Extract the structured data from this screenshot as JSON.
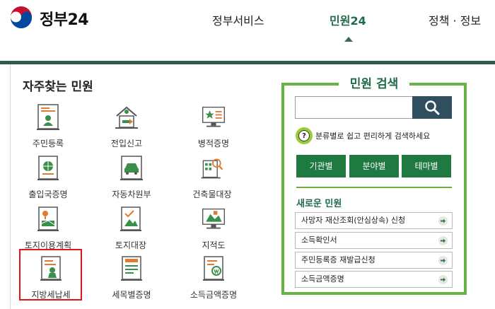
{
  "header": {
    "logo_text": "정부24",
    "nav": [
      "정부서비스",
      "민원24",
      "정책 · 정보"
    ]
  },
  "favorites": {
    "title": "자주찾는 민원",
    "items": [
      {
        "label": "주민등록",
        "icon": "resident-registration-icon"
      },
      {
        "label": "전입신고",
        "icon": "move-in-report-icon"
      },
      {
        "label": "병적증명",
        "icon": "military-record-icon"
      },
      {
        "label": "출입국증명",
        "icon": "immigration-certificate-icon"
      },
      {
        "label": "자동차원부",
        "icon": "vehicle-register-icon"
      },
      {
        "label": "건축물대장",
        "icon": "building-register-icon"
      },
      {
        "label": "토지이용계획",
        "icon": "land-use-plan-icon"
      },
      {
        "label": "토지대장",
        "icon": "land-register-icon"
      },
      {
        "label": "지적도",
        "icon": "cadastral-map-icon"
      },
      {
        "label": "지방세납세",
        "icon": "local-tax-payment-icon"
      },
      {
        "label": "세목별증명",
        "icon": "tax-item-certificate-icon"
      },
      {
        "label": "소득금액증명",
        "icon": "income-certificate-icon"
      }
    ]
  },
  "search": {
    "title": "민원 검색",
    "input_value": "",
    "hint": "분류별로 쉽고 편리하게 검색하세요",
    "categories": [
      "기관별",
      "분야별",
      "테마별"
    ]
  },
  "new_services": {
    "title": "새로운 민원",
    "items": [
      "사망자 재산조회(안심상속) 신청",
      "소득확인서",
      "주민등록증 재발급신청",
      "소득금액증명"
    ]
  },
  "colors": {
    "brand_dark_green": "#2e5a47",
    "accent_green": "#68b343",
    "button_green": "#1f7a41",
    "highlight_red": "#e3141a"
  }
}
